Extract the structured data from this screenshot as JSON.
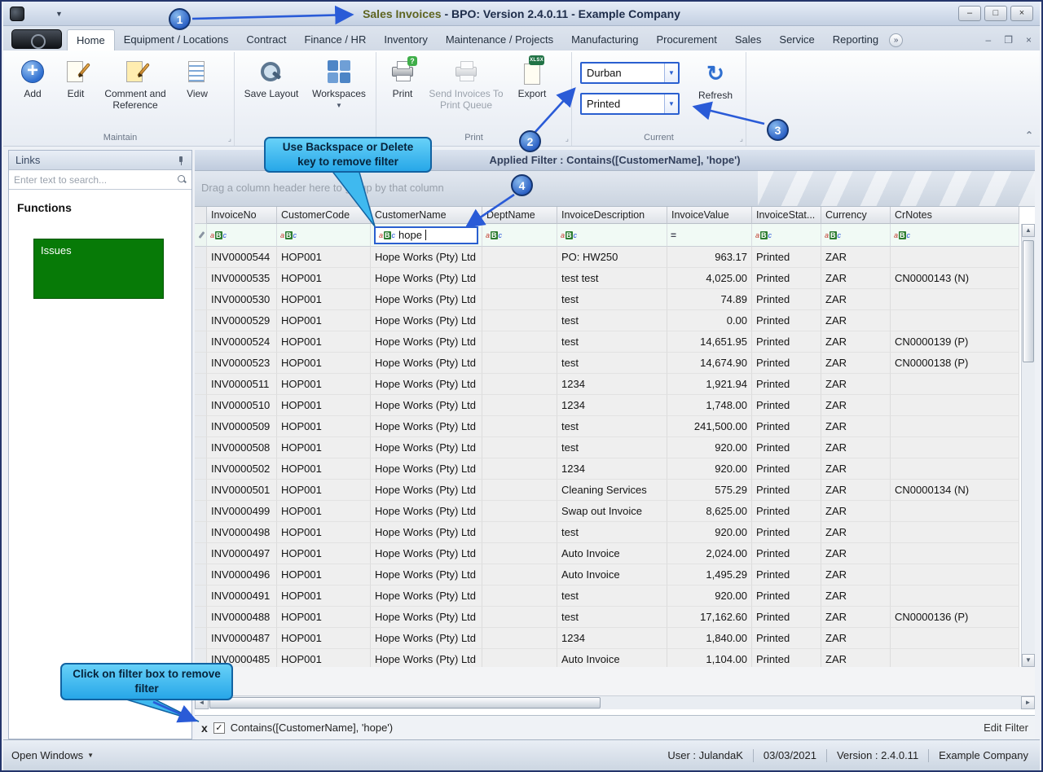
{
  "window": {
    "title_app": "Sales Invoices",
    "title_rest": " - BPO: Version 2.4.0.11 - Example Company",
    "minimize": "–",
    "restore": "□",
    "close": "×"
  },
  "ribbon": {
    "tabs": [
      "Home",
      "Equipment / Locations",
      "Contract",
      "Finance / HR",
      "Inventory",
      "Maintenance / Projects",
      "Manufacturing",
      "Procurement",
      "Sales",
      "Service",
      "Reporting"
    ],
    "active_tab": 0,
    "groups": {
      "maintain": "Maintain",
      "print": "Print",
      "current": "Current"
    },
    "buttons": {
      "add": "Add",
      "edit": "Edit",
      "comment": "Comment and Reference",
      "view": "View",
      "save_layout": "Save Layout",
      "workspaces": "Workspaces",
      "print": "Print",
      "send": "Send Invoices To Print Queue",
      "export": "Export",
      "refresh": "Refresh"
    },
    "icons": {
      "print_badge": "?",
      "export_badge": "XLSX"
    },
    "combos": {
      "site": "Durban",
      "status": "Printed"
    }
  },
  "sidebar": {
    "title": "Links",
    "search_placeholder": "Enter text to search...",
    "functions_label": "Functions",
    "item": "Issues"
  },
  "grid": {
    "applied_filter": "Applied Filter : Contains([CustomerName], 'hope')",
    "group_hint": "Drag a column header here to group by that column",
    "icons": {
      "text_filter": "aBc",
      "numeric_filter": "="
    },
    "columns": [
      {
        "label": "InvoiceNo",
        "filter": "abc"
      },
      {
        "label": "CustomerCode",
        "filter": "abc"
      },
      {
        "label": "CustomerName",
        "filter": "input",
        "filter_value": "hope",
        "sort": "asc"
      },
      {
        "label": "DeptName",
        "filter": "abc"
      },
      {
        "label": "InvoiceDescription",
        "filter": "abc"
      },
      {
        "label": "InvoiceValue",
        "filter": "eq",
        "align": "right"
      },
      {
        "label": "InvoiceStat...",
        "filter": "abc"
      },
      {
        "label": "Currency",
        "filter": "abc"
      },
      {
        "label": "CrNotes",
        "filter": "abc"
      }
    ],
    "rows": [
      [
        "INV0000544",
        "HOP001",
        "Hope Works (Pty) Ltd",
        "",
        "PO: HW250",
        "963.17",
        "Printed",
        "ZAR",
        ""
      ],
      [
        "INV0000535",
        "HOP001",
        "Hope Works (Pty) Ltd",
        "",
        "test test",
        "4,025.00",
        "Printed",
        "ZAR",
        "CN0000143 (N)"
      ],
      [
        "INV0000530",
        "HOP001",
        "Hope Works (Pty) Ltd",
        "",
        "test",
        "74.89",
        "Printed",
        "ZAR",
        ""
      ],
      [
        "INV0000529",
        "HOP001",
        "Hope Works (Pty) Ltd",
        "",
        "test",
        "0.00",
        "Printed",
        "ZAR",
        ""
      ],
      [
        "INV0000524",
        "HOP001",
        "Hope Works (Pty) Ltd",
        "",
        "test",
        "14,651.95",
        "Printed",
        "ZAR",
        "CN0000139 (P)"
      ],
      [
        "INV0000523",
        "HOP001",
        "Hope Works (Pty) Ltd",
        "",
        "test",
        "14,674.90",
        "Printed",
        "ZAR",
        "CN0000138 (P)"
      ],
      [
        "INV0000511",
        "HOP001",
        "Hope Works (Pty) Ltd",
        "",
        "1234",
        "1,921.94",
        "Printed",
        "ZAR",
        ""
      ],
      [
        "INV0000510",
        "HOP001",
        "Hope Works (Pty) Ltd",
        "",
        "1234",
        "1,748.00",
        "Printed",
        "ZAR",
        ""
      ],
      [
        "INV0000509",
        "HOP001",
        "Hope Works (Pty) Ltd",
        "",
        "test",
        "241,500.00",
        "Printed",
        "ZAR",
        ""
      ],
      [
        "INV0000508",
        "HOP001",
        "Hope Works (Pty) Ltd",
        "",
        "test",
        "920.00",
        "Printed",
        "ZAR",
        ""
      ],
      [
        "INV0000502",
        "HOP001",
        "Hope Works (Pty) Ltd",
        "",
        "1234",
        "920.00",
        "Printed",
        "ZAR",
        ""
      ],
      [
        "INV0000501",
        "HOP001",
        "Hope Works (Pty) Ltd",
        "",
        "Cleaning Services",
        "575.29",
        "Printed",
        "ZAR",
        "CN0000134 (N)"
      ],
      [
        "INV0000499",
        "HOP001",
        "Hope Works (Pty) Ltd",
        "",
        "Swap out Invoice",
        "8,625.00",
        "Printed",
        "ZAR",
        ""
      ],
      [
        "INV0000498",
        "HOP001",
        "Hope Works (Pty) Ltd",
        "",
        "test",
        "920.00",
        "Printed",
        "ZAR",
        ""
      ],
      [
        "INV0000497",
        "HOP001",
        "Hope Works (Pty) Ltd",
        "",
        "Auto Invoice",
        "2,024.00",
        "Printed",
        "ZAR",
        ""
      ],
      [
        "INV0000496",
        "HOP001",
        "Hope Works (Pty) Ltd",
        "",
        "Auto Invoice",
        "1,495.29",
        "Printed",
        "ZAR",
        ""
      ],
      [
        "INV0000491",
        "HOP001",
        "Hope Works (Pty) Ltd",
        "",
        "test",
        "920.00",
        "Printed",
        "ZAR",
        ""
      ],
      [
        "INV0000488",
        "HOP001",
        "Hope Works (Pty) Ltd",
        "",
        "test",
        "17,162.60",
        "Printed",
        "ZAR",
        "CN0000136 (P)"
      ],
      [
        "INV0000487",
        "HOP001",
        "Hope Works (Pty) Ltd",
        "",
        "1234",
        "1,840.00",
        "Printed",
        "ZAR",
        ""
      ],
      [
        "INV0000485",
        "HOP001",
        "Hope Works (Pty) Ltd",
        "",
        "Auto Invoice",
        "1,104.00",
        "Printed",
        "ZAR",
        ""
      ]
    ]
  },
  "filter_panel": {
    "close": "x",
    "check": "✓",
    "label": "Contains([CustomerName], 'hope')",
    "edit": "Edit Filter"
  },
  "statusbar": {
    "open_windows": "Open Windows",
    "user": "User : JulandaK",
    "date": "03/03/2021",
    "version": "Version : 2.4.0.11",
    "company": "Example Company"
  },
  "callouts": {
    "n1": "1",
    "n2": "2",
    "n3": "3",
    "n4": "4",
    "tip_top": "Use Backspace or Delete key to remove filter",
    "tip_bottom": "Click on filter box to remove filter"
  },
  "colors": {
    "accent_blue": "#2a5fd0",
    "callout_fill": "#3fb9ef",
    "issues_green": "#077a07"
  }
}
